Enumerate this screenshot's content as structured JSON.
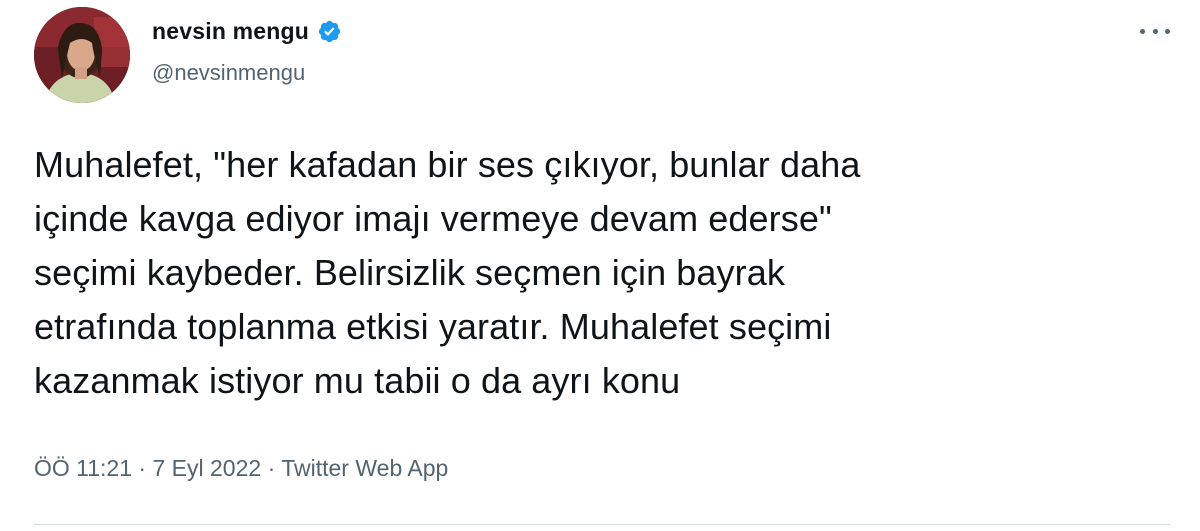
{
  "author": {
    "display_name": "nevsin mengu",
    "handle": "@nevsinmengu",
    "verified": true
  },
  "tweet": {
    "lines": [
      "Muhalefet, \"her kafadan bir ses çıkıyor, bunlar daha",
      "içinde kavga ediyor imajı vermeye devam ederse\"",
      "seçimi kaybeder. Belirsizlik seçmen için bayrak",
      "etrafında toplanma etkisi yaratır. Muhalefet seçimi",
      "kazanmak istiyor mu tabii o da ayrı konu"
    ],
    "time": "ÖÖ 11:21",
    "separator1": "·",
    "date": "7 Eyl 2022",
    "separator2": "·",
    "source": "Twitter Web App"
  },
  "icons": {
    "verified": "verified-badge-icon",
    "more": "more-options-icon"
  },
  "colors": {
    "verified_blue": "#1d9bf0",
    "secondary_text": "#536471",
    "primary_text": "#0f1419",
    "divider": "#cfd9de"
  }
}
